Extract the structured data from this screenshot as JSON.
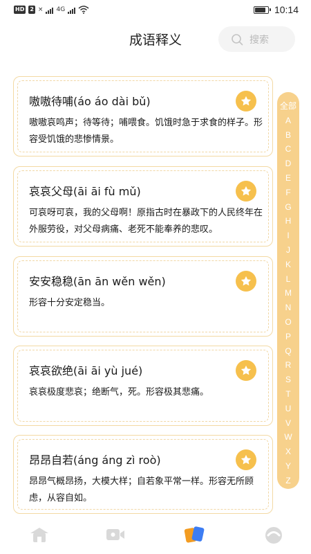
{
  "status_bar": {
    "network_badges": [
      "HD",
      "2"
    ],
    "signal_labels": [
      "×",
      "4G"
    ],
    "time": "10:14",
    "battery_level": 0.85
  },
  "header": {
    "title": "成语释义",
    "search_placeholder": "搜索"
  },
  "idioms": [
    {
      "title": "嗷嗷待哺(áo áo dài bǔ)",
      "definition": "嗷嗷哀鸣声；待等待；哺喂食。饥饿时急于求食的样子。形容受饥饿的悲惨情景。"
    },
    {
      "title": "哀哀父母(āi āi fù mǔ)",
      "definition": "可哀呀可哀，我的父母啊！原指古时在暴政下的人民终年在外服劳役，对父母病痛、老死不能奉养的悲叹。"
    },
    {
      "title": "安安稳稳(ān ān wěn wěn)",
      "definition": "形容十分安定稳当。"
    },
    {
      "title": "哀哀欲绝(āi āi yù jué)",
      "definition": "哀哀极度悲哀；绝断气，死。形容极其悲痛。"
    },
    {
      "title": "昂昂自若(áng áng zì roò)",
      "definition": "昂昂气概昂扬，大模大样；自若象平常一样。形容无所顾虑，从容自如。"
    }
  ],
  "alphabet_index": [
    "全部",
    "A",
    "B",
    "C",
    "D",
    "E",
    "F",
    "G",
    "H",
    "I",
    "J",
    "K",
    "L",
    "M",
    "N",
    "O",
    "P",
    "Q",
    "R",
    "S",
    "T",
    "U",
    "V",
    "W",
    "X",
    "Y",
    "Z"
  ],
  "bottom_nav": [
    {
      "icon": "house-icon",
      "active": false
    },
    {
      "icon": "video-icon",
      "active": false
    },
    {
      "icon": "cards-icon",
      "active": true
    },
    {
      "icon": "profile-icon",
      "active": false
    }
  ],
  "colors": {
    "accent": "#f6c04d",
    "card_border": "#f3d9a3",
    "index_bar": "#f7d18c",
    "nav_active_orange": "#f39c21",
    "nav_active_blue": "#3d7df3",
    "nav_inactive": "#d9d9d9"
  }
}
